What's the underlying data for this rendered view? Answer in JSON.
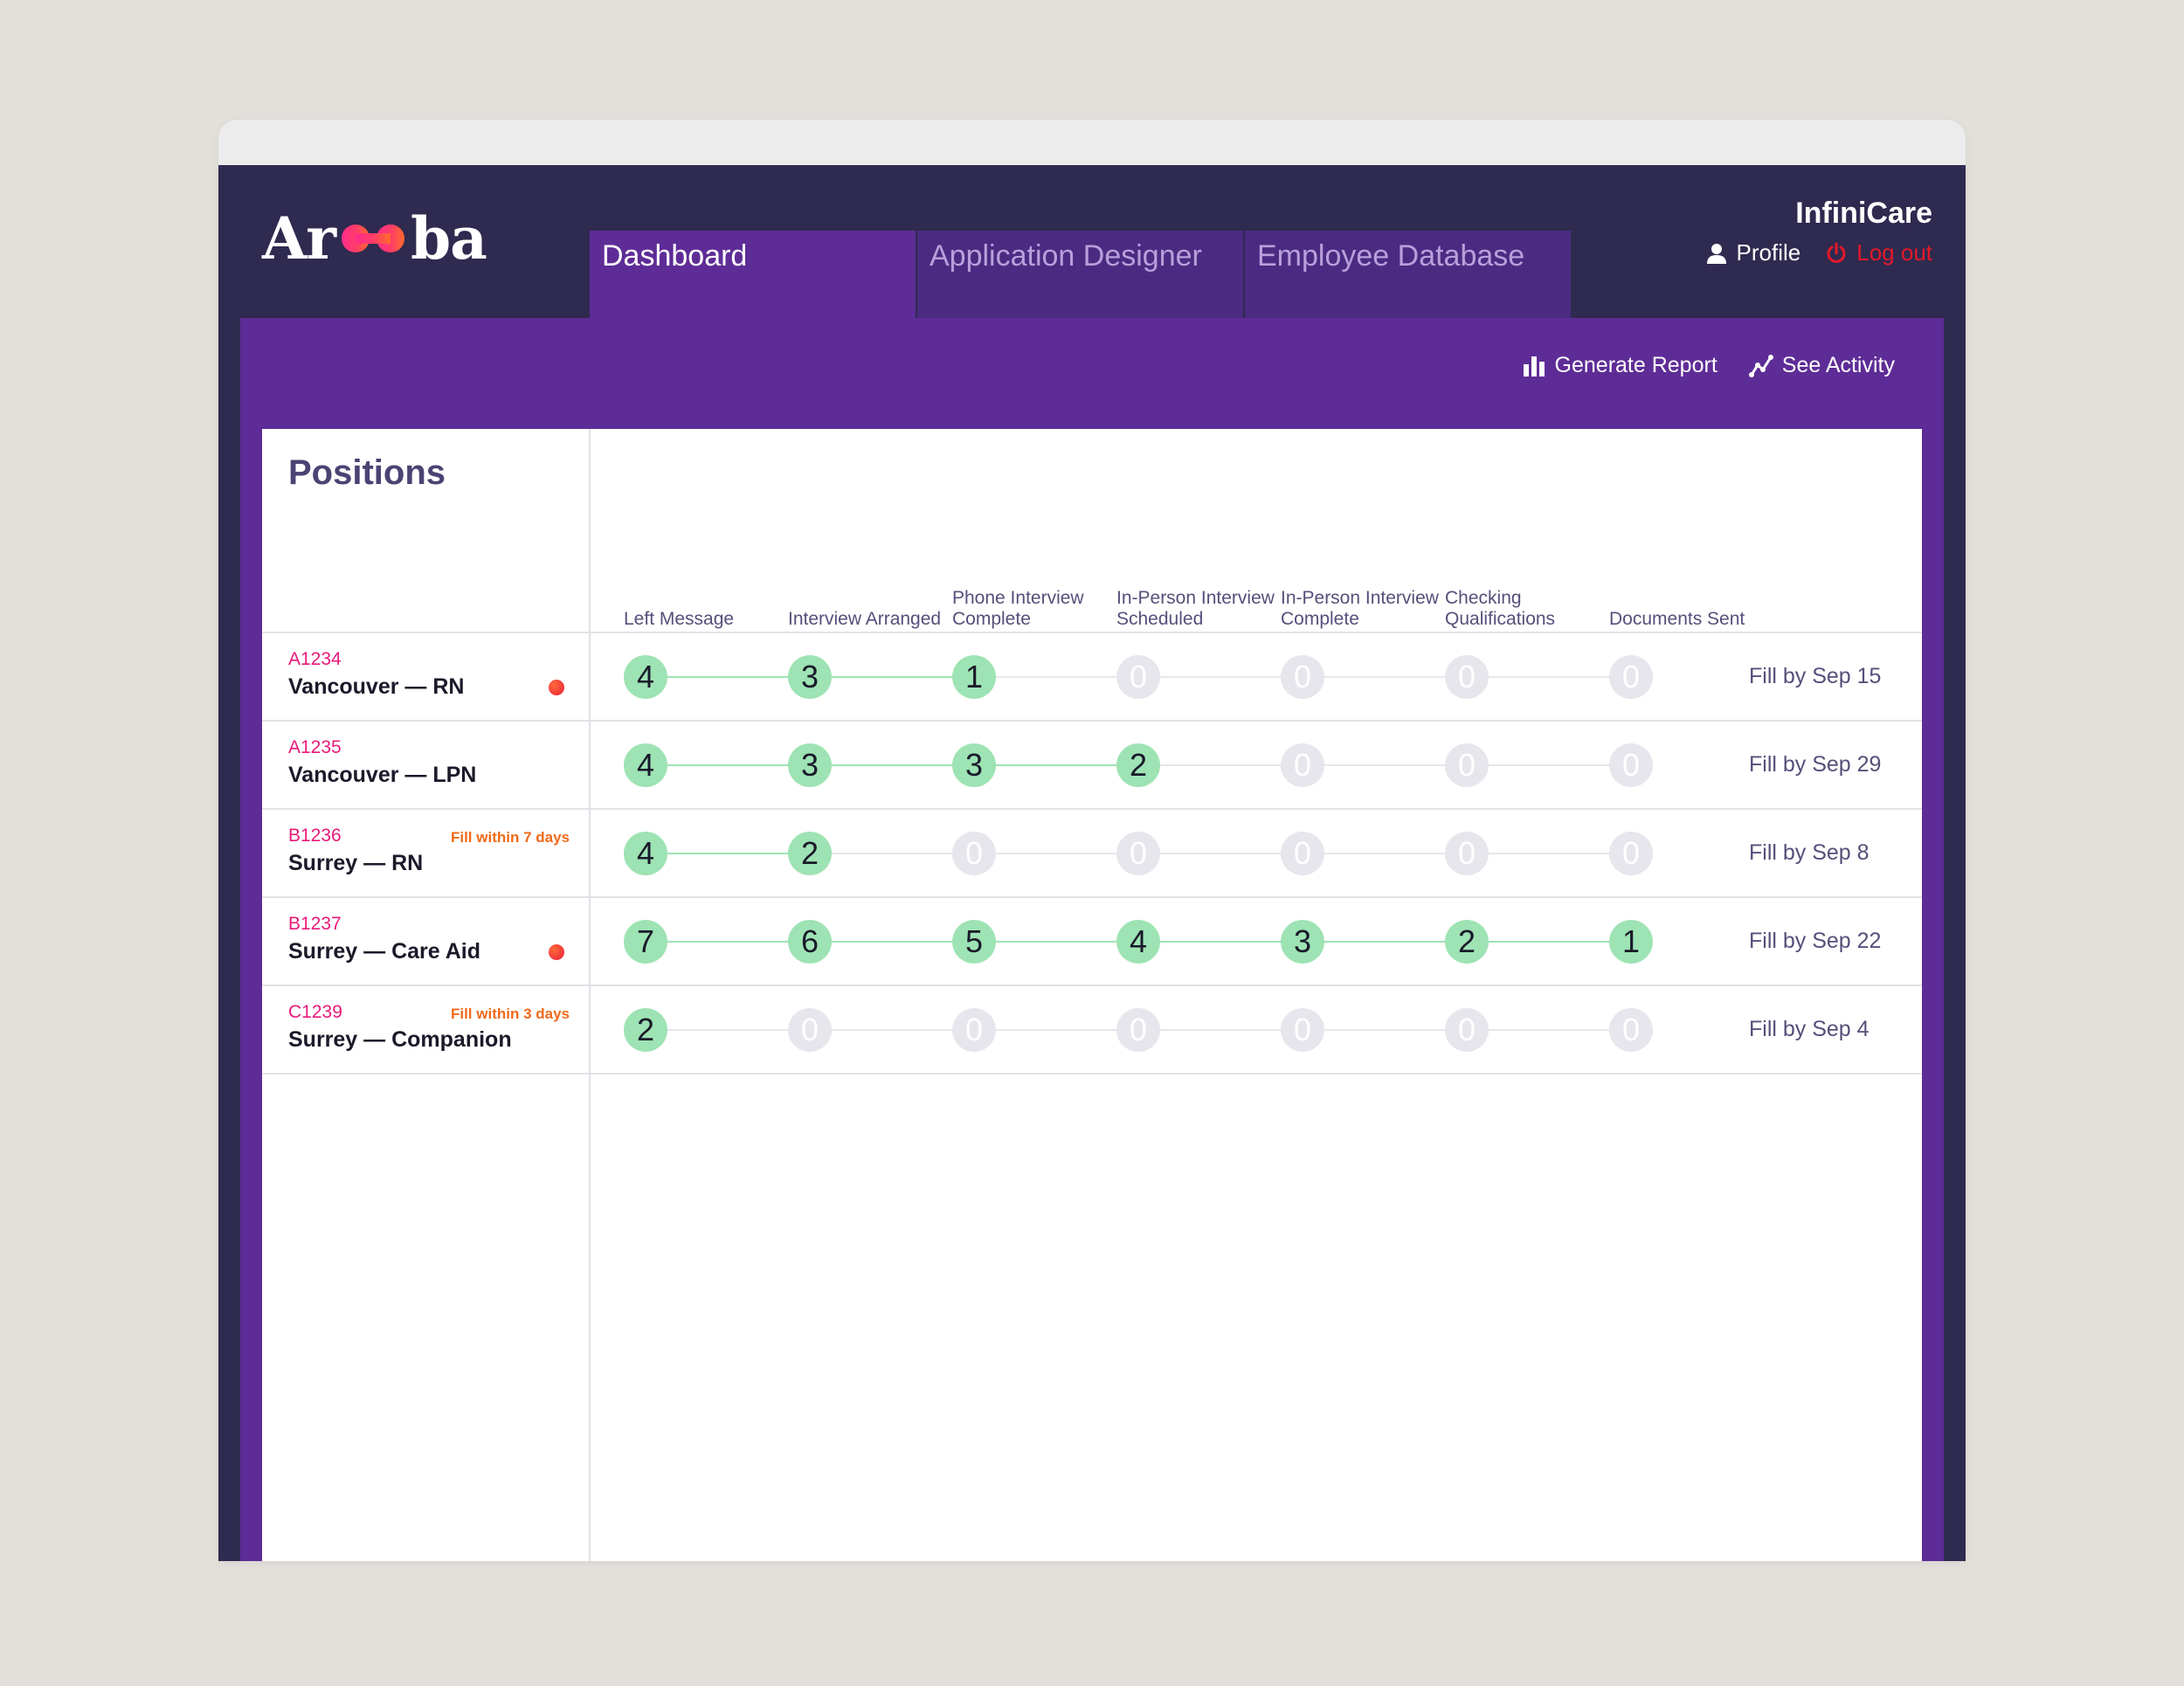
{
  "app": {
    "logo_left": "Ar",
    "logo_right": "ba",
    "company": "InfiniCare",
    "profile_label": "Profile",
    "logout_label": "Log out"
  },
  "tabs": [
    {
      "label": "Dashboard",
      "active": true
    },
    {
      "label": "Application Designer",
      "active": false
    },
    {
      "label": "Employee Database",
      "active": false
    }
  ],
  "toolbar": {
    "report_label": "Generate Report",
    "activity_label": "See Activity"
  },
  "positions": {
    "title": "Positions",
    "stages": [
      "Left Message",
      "Interview Arranged",
      "Phone Interview Complete",
      "In-Person Interview Scheduled",
      "In-Person Interview Complete",
      "Checking Qualifications",
      "Documents Sent"
    ],
    "rows": [
      {
        "code": "A1234",
        "name": "Vancouver — RN",
        "urgency": "",
        "alert": true,
        "counts": [
          4,
          3,
          1,
          0,
          0,
          0,
          0
        ],
        "fill_by": "Fill by Sep 15"
      },
      {
        "code": "A1235",
        "name": "Vancouver — LPN",
        "urgency": "",
        "alert": false,
        "counts": [
          4,
          3,
          3,
          2,
          0,
          0,
          0
        ],
        "fill_by": "Fill by Sep 29"
      },
      {
        "code": "B1236",
        "name": "Surrey — RN",
        "urgency": "Fill within 7 days",
        "alert": false,
        "counts": [
          4,
          2,
          0,
          0,
          0,
          0,
          0
        ],
        "fill_by": "Fill by Sep 8"
      },
      {
        "code": "B1237",
        "name": "Surrey — Care Aid",
        "urgency": "",
        "alert": true,
        "counts": [
          7,
          6,
          5,
          4,
          3,
          2,
          1
        ],
        "fill_by": "Fill by Sep 22"
      },
      {
        "code": "C1239",
        "name": "Surrey — Companion",
        "urgency": "Fill within 3 days",
        "alert": false,
        "counts": [
          2,
          0,
          0,
          0,
          0,
          0,
          0
        ],
        "fill_by": "Fill by Sep 4"
      }
    ]
  },
  "colors": {
    "header_bg": "#2f2a4f",
    "accent_purple": "#5e2c96",
    "active_stage": "#9ee3b4",
    "inactive_stage": "#e6e6ec",
    "code_pink": "#e8197a",
    "urgency_orange": "#f06a1a",
    "logout_red": "#e3192b"
  },
  "icons": [
    "logo-mark",
    "user-icon",
    "power-icon",
    "bar-chart-icon",
    "activity-icon",
    "alert-dot"
  ]
}
